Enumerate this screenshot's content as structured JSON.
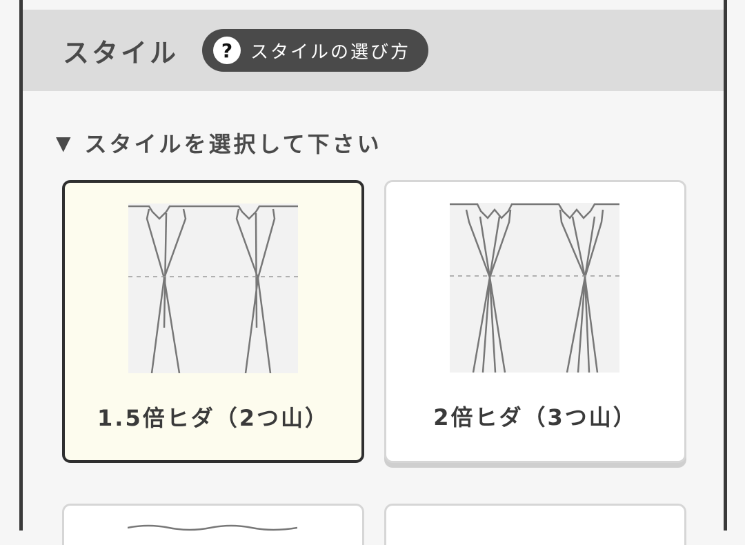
{
  "section": {
    "title": "スタイル",
    "help_label": "スタイルの選び方"
  },
  "instruction": {
    "text": "スタイルを選択して下さい"
  },
  "options": [
    {
      "label": "1.5倍ヒダ（2つ山）",
      "selected": true
    },
    {
      "label": "2倍ヒダ（3つ山）",
      "selected": false
    }
  ],
  "colors": {
    "header_bg": "#dcdcdc",
    "pill_bg": "#4a4a4a",
    "selected_bg": "#fdfcee",
    "selected_border": "#2f2f2f"
  }
}
